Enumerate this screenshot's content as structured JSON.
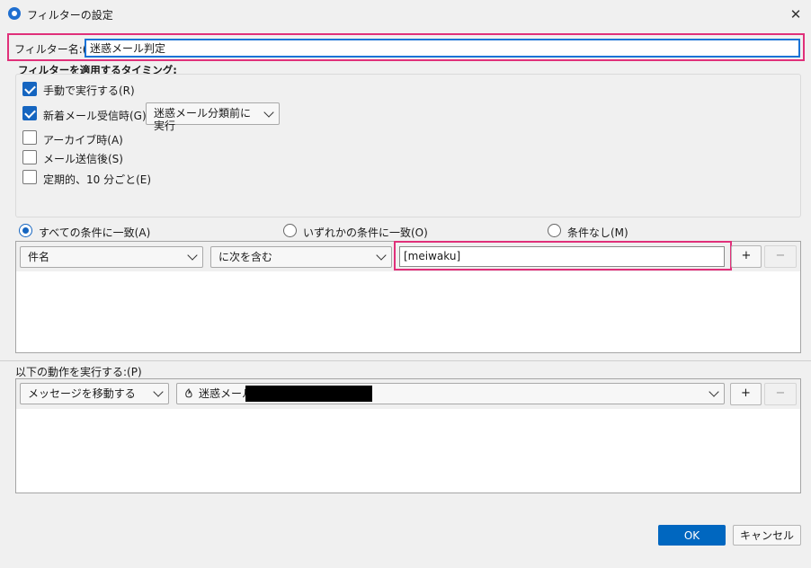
{
  "window": {
    "title": "フィルターの設定",
    "close_symbol": "✕"
  },
  "filter_name": {
    "label": "フィルター名:(I)",
    "value": "迷惑メール判定"
  },
  "timing": {
    "heading": "フィルターを適用するタイミング:",
    "manual": {
      "label": "手動で実行する(R)",
      "checked": true
    },
    "new_mail": {
      "label": "新着メール受信時(G):",
      "checked": true,
      "select_value": "迷惑メール分類前に実行"
    },
    "archive": {
      "label": "アーカイブ時(A)",
      "checked": false
    },
    "after_send": {
      "label": "メール送信後(S)",
      "checked": false
    },
    "periodic": {
      "label": "定期的、10 分ごと(E)",
      "checked": false
    }
  },
  "match": {
    "all": "すべての条件に一致(A)",
    "any": "いずれかの条件に一致(O)",
    "none": "条件なし(M)",
    "selected": "all"
  },
  "rule": {
    "field": "件名",
    "operator": "に次を含む",
    "value": "[meiwaku]",
    "add": "+",
    "remove": "−"
  },
  "actions": {
    "label": "以下の動作を実行する:(P)",
    "action": "メッセージを移動する",
    "target_folder": "迷惑メール",
    "add": "+",
    "remove": "−"
  },
  "footer": {
    "ok": "OK",
    "cancel": "キャンセル"
  },
  "colors": {
    "accent": "#1565c0",
    "highlight": "#e0307a",
    "ok_button": "#0067c0"
  }
}
